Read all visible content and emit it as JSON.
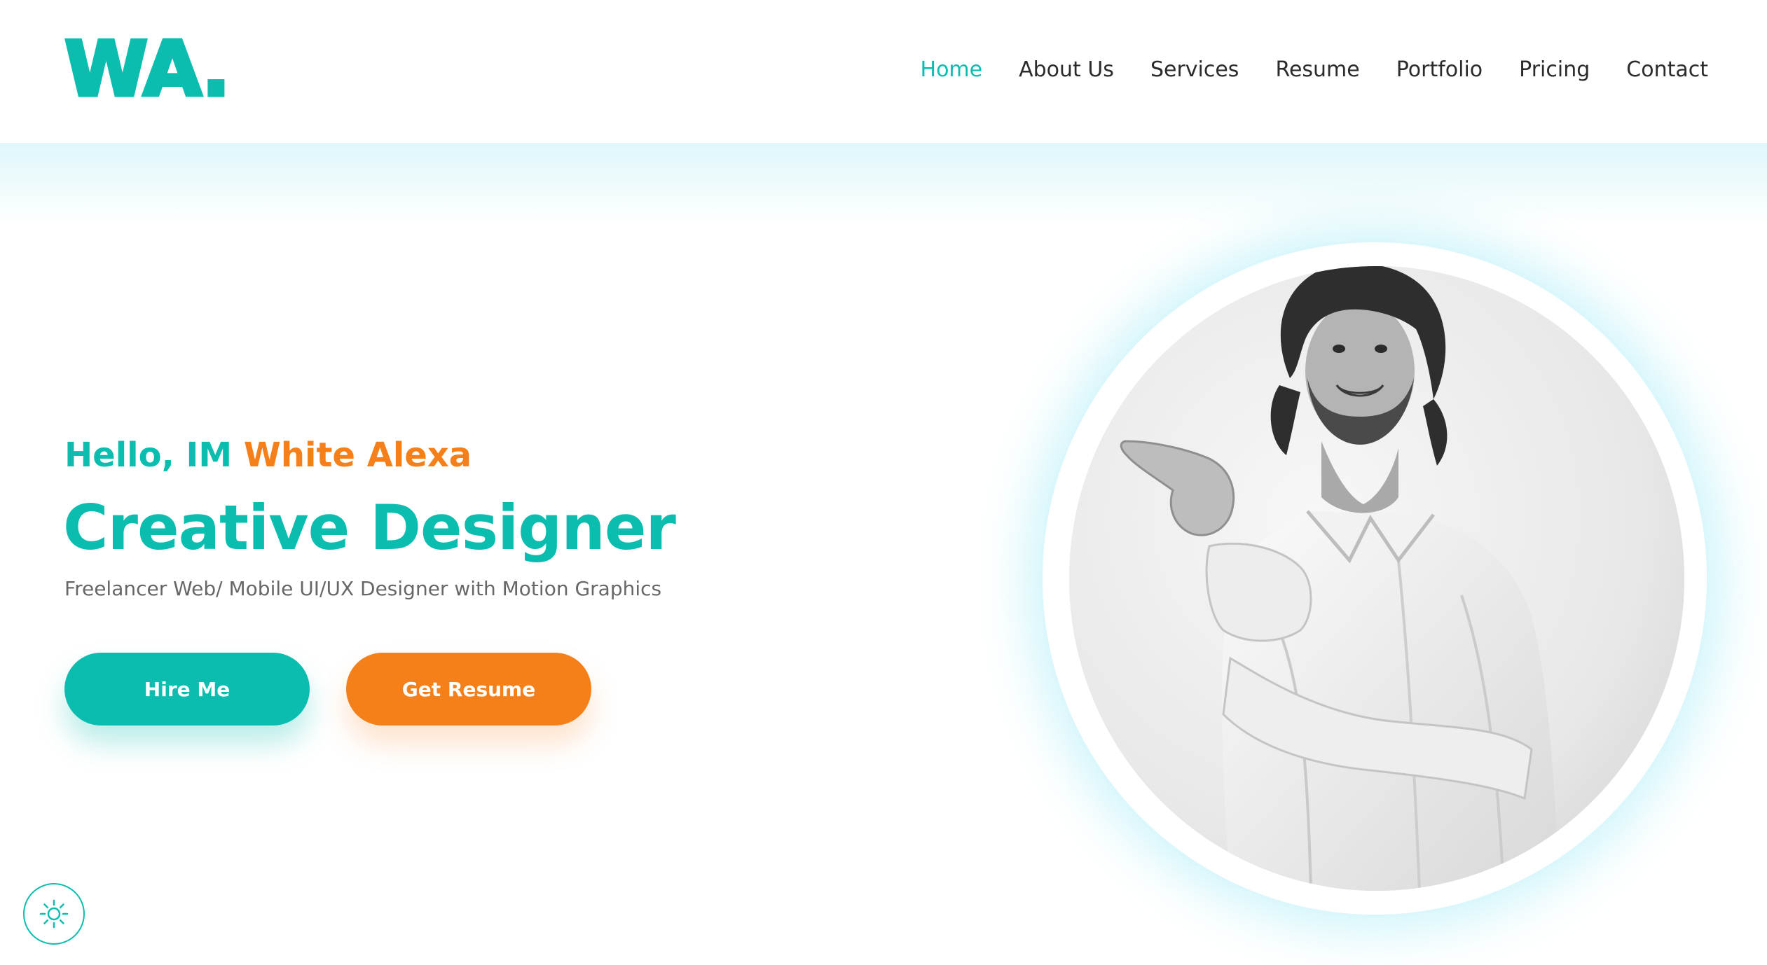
{
  "header": {
    "logo": "WA.",
    "nav": [
      {
        "label": "Home",
        "active": true
      },
      {
        "label": "About Us",
        "active": false
      },
      {
        "label": "Services",
        "active": false
      },
      {
        "label": "Resume",
        "active": false
      },
      {
        "label": "Portfolio",
        "active": false
      },
      {
        "label": "Pricing",
        "active": false
      },
      {
        "label": "Contact",
        "active": false
      }
    ]
  },
  "hero": {
    "greeting_prefix": "Hello, IM",
    "greeting_name": "White Alexa",
    "title": "Creative Designer",
    "subtitle": "Freelancer Web/ Mobile UI/UX Designer with Motion Graphics",
    "buttons": {
      "hire_label": "Hire Me",
      "resume_label": "Get Resume"
    }
  },
  "portrait": {
    "icon": "portrait-photo"
  },
  "theme_toggle": {
    "icon": "sun-icon"
  },
  "colors": {
    "teal": "#0bbdaf",
    "orange": "#f5801a",
    "text_dark": "#2b2b2b",
    "text_muted": "#676767",
    "glow": "#bef0f8"
  }
}
